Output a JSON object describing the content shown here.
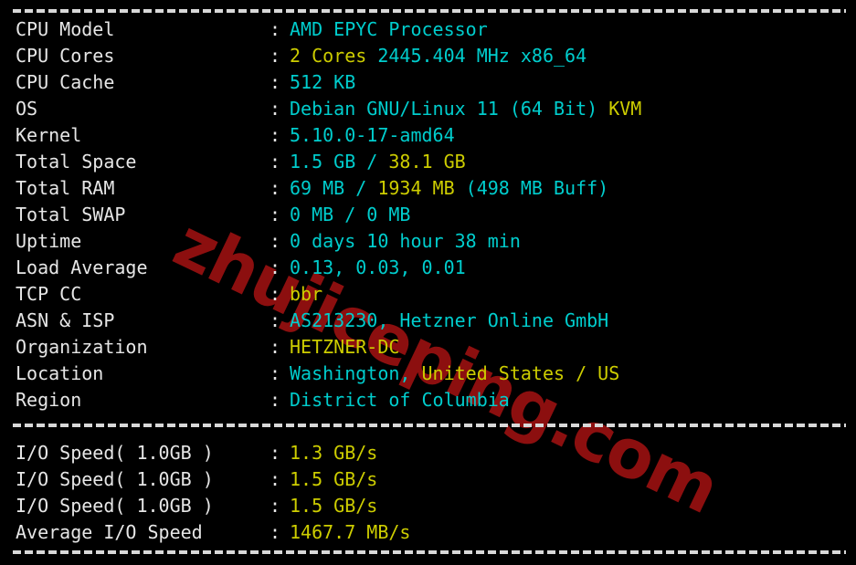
{
  "terminal": {
    "title": "bench.sh system information output",
    "background_color": "#000000",
    "label_color": "#e6e6e6",
    "cyan": "#00cdcd",
    "yellow": "#cdcd00",
    "separator_char": "-",
    "separators": [
      "top",
      "middle",
      "bottom"
    ]
  },
  "watermark": {
    "text": "zhujiceping.com",
    "color": "#8c0f0f",
    "rotation_deg": 25.5
  },
  "system_info": {
    "separator_label": "dashed-separator",
    "colon": ":",
    "rows": [
      {
        "label": "CPU Model",
        "parts": [
          {
            "text": "AMD EPYC Processor",
            "color": "cyan"
          }
        ]
      },
      {
        "label": "CPU Cores",
        "parts": [
          {
            "text": "2 Cores",
            "color": "yellow"
          },
          {
            "text": " 2445.404 MHz x86_64",
            "color": "cyan"
          }
        ]
      },
      {
        "label": "CPU Cache",
        "parts": [
          {
            "text": "512 KB",
            "color": "cyan"
          }
        ]
      },
      {
        "label": "OS",
        "parts": [
          {
            "text": "Debian GNU/Linux 11 (64 Bit)",
            "color": "cyan"
          },
          {
            "text": " KVM",
            "color": "yellow"
          }
        ]
      },
      {
        "label": "Kernel",
        "parts": [
          {
            "text": "5.10.0-17-amd64",
            "color": "cyan"
          }
        ]
      },
      {
        "label": "Total Space",
        "parts": [
          {
            "text": "1.5 GB ",
            "color": "cyan"
          },
          {
            "text": "/",
            "color": "cyan"
          },
          {
            "text": " 38.1 GB",
            "color": "yellow"
          }
        ]
      },
      {
        "label": "Total RAM",
        "parts": [
          {
            "text": "69 MB ",
            "color": "cyan"
          },
          {
            "text": "/",
            "color": "cyan"
          },
          {
            "text": " 1934 MB",
            "color": "yellow"
          },
          {
            "text": " (498 MB Buff)",
            "color": "cyan"
          }
        ]
      },
      {
        "label": "Total SWAP",
        "parts": [
          {
            "text": "0 MB / 0 MB",
            "color": "cyan"
          }
        ]
      },
      {
        "label": "Uptime",
        "parts": [
          {
            "text": "0 days 10 hour 38 min",
            "color": "cyan"
          }
        ]
      },
      {
        "label": "Load Average",
        "parts": [
          {
            "text": "0.13, 0.03, 0.01",
            "color": "cyan"
          }
        ]
      },
      {
        "label": "TCP CC",
        "parts": [
          {
            "text": "bbr",
            "color": "yellow"
          }
        ]
      },
      {
        "label": "ASN & ISP",
        "parts": [
          {
            "text": "AS213230, Hetzner Online GmbH",
            "color": "cyan"
          }
        ]
      },
      {
        "label": "Organization",
        "parts": [
          {
            "text": "HETZNER-DC",
            "color": "yellow"
          }
        ]
      },
      {
        "label": "Location",
        "parts": [
          {
            "text": "Washington, ",
            "color": "cyan"
          },
          {
            "text": "United States / US",
            "color": "yellow"
          }
        ]
      },
      {
        "label": "Region",
        "parts": [
          {
            "text": "District of Columbia",
            "color": "cyan"
          }
        ]
      }
    ]
  },
  "io_benchmark": {
    "rows": [
      {
        "label": "I/O Speed( 1.0GB )",
        "parts": [
          {
            "text": "1.3 GB/s",
            "color": "yellow"
          }
        ]
      },
      {
        "label": "I/O Speed( 1.0GB )",
        "parts": [
          {
            "text": "1.5 GB/s",
            "color": "yellow"
          }
        ]
      },
      {
        "label": "I/O Speed( 1.0GB )",
        "parts": [
          {
            "text": "1.5 GB/s",
            "color": "yellow"
          }
        ]
      },
      {
        "label": "Average I/O Speed",
        "parts": [
          {
            "text": "1467.7 MB/s",
            "color": "yellow"
          }
        ]
      }
    ]
  }
}
